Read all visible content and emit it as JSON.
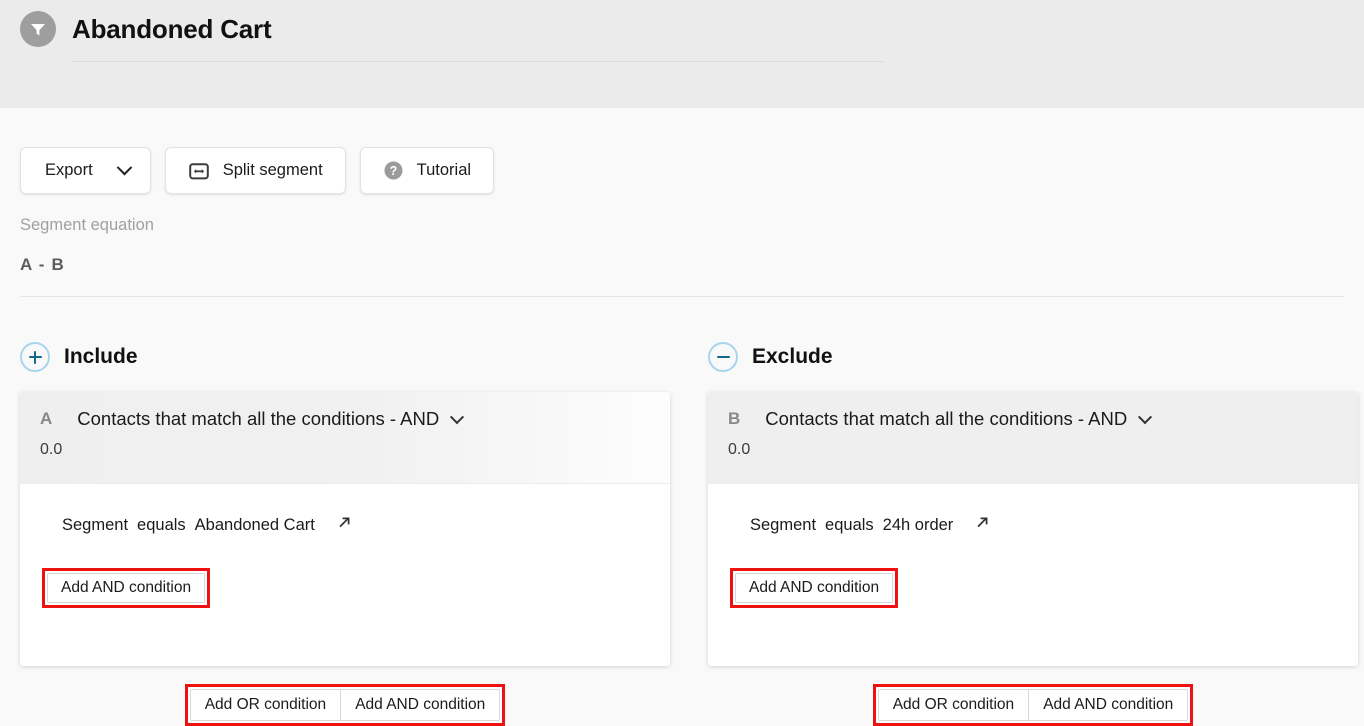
{
  "header": {
    "icon": "funnel-icon",
    "title": "Abandoned Cart"
  },
  "toolbar": {
    "export_label": "Export",
    "export_icon": "chevron-down-icon",
    "split_label": "Split segment",
    "split_icon": "split-segment-icon",
    "tutorial_label": "Tutorial",
    "tutorial_icon": "question-circle-icon"
  },
  "equation": {
    "label": "Segment equation",
    "value": "A - B"
  },
  "columns": [
    {
      "key": "include",
      "icon": "plus-circle-icon",
      "title": "Include",
      "card": {
        "letter": "A",
        "title": "Contacts that match all the conditions - AND",
        "chevron": "chevron-down-icon",
        "count": "0.0",
        "condition": {
          "field": "Segment",
          "operator": "equals",
          "value": "Abandoned Cart",
          "link_icon": "external-link-icon"
        },
        "add_and_label": "Add AND condition"
      },
      "footer": {
        "or_label": "Add OR condition",
        "and_label": "Add AND condition"
      }
    },
    {
      "key": "exclude",
      "icon": "minus-circle-icon",
      "title": "Exclude",
      "card": {
        "letter": "B",
        "title": "Contacts that match all the conditions - AND",
        "chevron": "chevron-down-icon",
        "count": "0.0",
        "condition": {
          "field": "Segment",
          "operator": "equals",
          "value": "24h order",
          "link_icon": "external-link-icon"
        },
        "add_and_label": "Add AND condition"
      },
      "footer": {
        "or_label": "Add OR condition",
        "and_label": "Add AND condition"
      }
    }
  ],
  "colors": {
    "header_band": "#ebebeb",
    "page_bg": "#f9f9f9",
    "badge_gray": "#9e9e9e",
    "circle_blue": "#a8d4ef",
    "glyph_blue": "#13688f",
    "annotation_red": "#ee1111"
  }
}
